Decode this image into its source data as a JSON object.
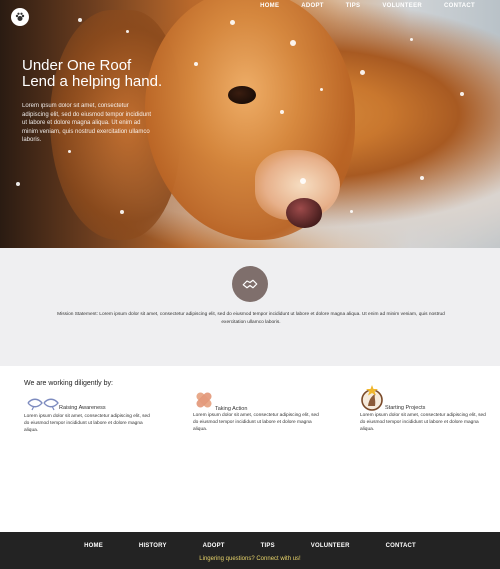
{
  "nav": {
    "items": [
      "HOME",
      "ADOPT",
      "TIPS",
      "VOLUNTEER",
      "CONTACT"
    ]
  },
  "hero": {
    "title_line1": "Under One Roof",
    "title_line2": "Lend a helping hand.",
    "body": "Lorem ipsum dolor sit amet, consectetur adipiscing elit, sed do eiusmod tempor incididunt ut labore et dolore magna aliqua. Ut enim ad minim veniam, quis nostrud exercitation ullamco laboris."
  },
  "mission": {
    "text": "Mission Statement: Lorem ipsum dolor sit amet, consectetur adipiscing elit, sed do eiusmod tempor incididunt ut labore et dolore magna aliqua. Ut enim ad minim veniam, quis nostrud exercitation ullamco laboris."
  },
  "working": {
    "title": "We are working diligently by:",
    "items": [
      {
        "name": "Raising Awareness",
        "text": "Lorem ipsum dolor sit amet, consectetur adipiscing elit, sed do eiusmod tempor incididunt ut labore et dolore magna aliqua.",
        "icon": "ribbons-icon"
      },
      {
        "name": "Taking Action",
        "text": "Lorem ipsum dolor sit amet, consectetur adipiscing elit, sed do eiusmod tempor incididunt ut labore et dolore magna aliqua.",
        "icon": "bandage-icon"
      },
      {
        "name": "Starting Projects",
        "text": "Lorem ipsum dolor sit amet, consectetur adipiscing elit, sed do eiusmod tempor incididunt ut labore et dolore magna aliqua.",
        "icon": "badge-icon"
      }
    ]
  },
  "footer": {
    "nav": [
      "HOME",
      "HISTORY",
      "ADOPT",
      "TIPS",
      "VOLUNTEER",
      "CONTACT"
    ],
    "cta_prefix": "Lingering questions? ",
    "cta_link": "Connect with us!"
  },
  "colors": {
    "mission_bg": "#efeff1",
    "mission_icon": "#7f6f6c",
    "footer_bg": "#232323",
    "cta": "#c8a64f"
  }
}
